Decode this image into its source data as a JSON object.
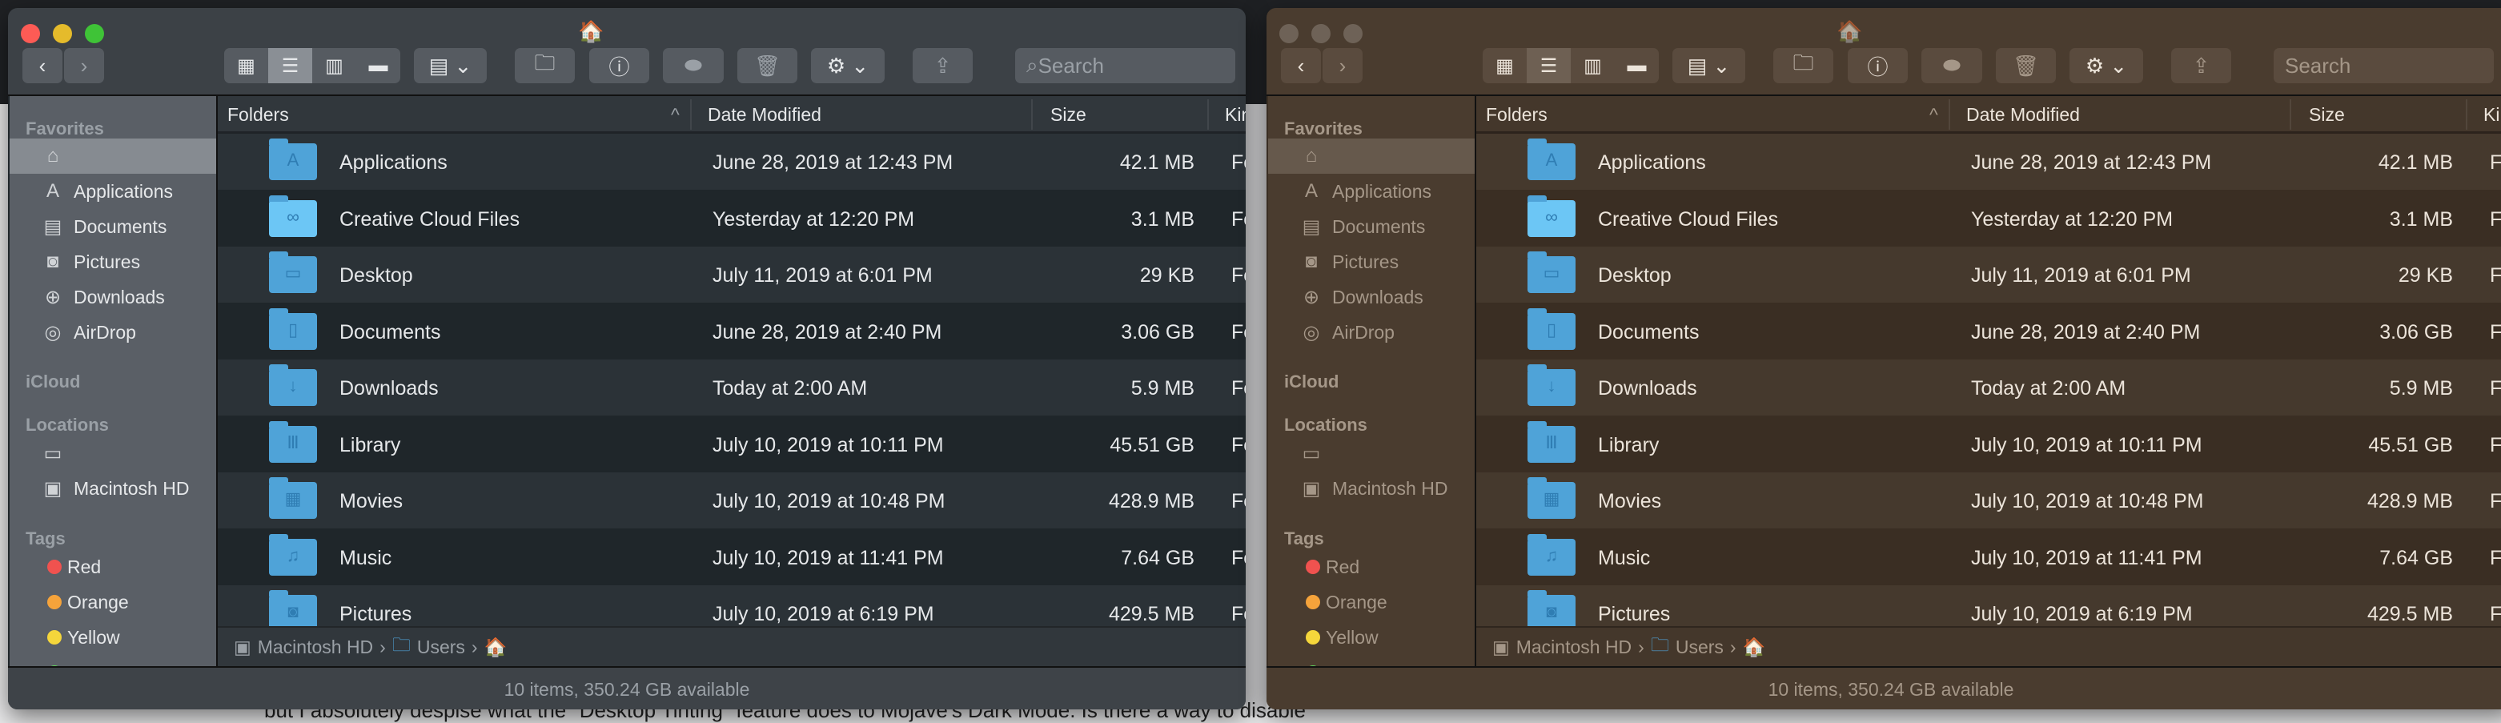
{
  "background_text": "but I absolutely despise what the \"Desktop Tinting\" feature does to Mojave's Dark Mode. Is there a way to disable",
  "toolbar": {
    "search_placeholder": "Search",
    "icons": [
      "back-icon",
      "forward-icon",
      "icon-view-icon",
      "list-view-icon",
      "column-view-icon",
      "gallery-view-icon",
      "group-icon",
      "new-folder-icon",
      "info-icon",
      "tag-icon",
      "trash-icon",
      "gear-icon",
      "share-icon",
      "search-icon"
    ]
  },
  "sidebar": {
    "favorites_label": "Favorites",
    "favorites": [
      {
        "label": "",
        "icon": "home-icon"
      },
      {
        "label": "Applications",
        "icon": "applications-icon"
      },
      {
        "label": "Documents",
        "icon": "documents-icon"
      },
      {
        "label": "Pictures",
        "icon": "camera-icon"
      },
      {
        "label": "Downloads",
        "icon": "downloads-icon"
      },
      {
        "label": "AirDrop",
        "icon": "airdrop-icon"
      }
    ],
    "icloud_label": "iCloud",
    "locations_label": "Locations",
    "locations": [
      {
        "label": "",
        "icon": "laptop-icon"
      },
      {
        "label": "Macintosh HD",
        "icon": "disk-icon"
      }
    ],
    "tags_label": "Tags",
    "tags": [
      {
        "label": "Red",
        "color": "#f0524f"
      },
      {
        "label": "Orange",
        "color": "#f5a33b"
      },
      {
        "label": "Yellow",
        "color": "#f5d63b"
      },
      {
        "label": "Green",
        "color": "#5fd35a"
      }
    ]
  },
  "columns": {
    "name": "Folders",
    "date": "Date Modified",
    "size": "Size",
    "kind": "Kind"
  },
  "rows": [
    {
      "name": "Applications",
      "date": "June 28, 2019 at 12:43 PM",
      "size": "42.1 MB",
      "kind": "Folder",
      "glyph": "applications"
    },
    {
      "name": "Creative Cloud Files",
      "date": "Yesterday at 12:20 PM",
      "size": "3.1 MB",
      "kind": "Folder",
      "glyph": "creative-cloud"
    },
    {
      "name": "Desktop",
      "date": "July 11, 2019 at 6:01 PM",
      "size": "29 KB",
      "kind": "Folder",
      "glyph": "desktop"
    },
    {
      "name": "Documents",
      "date": "June 28, 2019 at 2:40 PM",
      "size": "3.06 GB",
      "kind": "Folder",
      "glyph": "documents"
    },
    {
      "name": "Downloads",
      "date": "Today at 2:00 AM",
      "size": "5.9 MB",
      "kind": "Folder",
      "glyph": "downloads"
    },
    {
      "name": "Library",
      "date": "July 10, 2019 at 10:11 PM",
      "size": "45.51 GB",
      "kind": "Folder",
      "glyph": "library"
    },
    {
      "name": "Movies",
      "date": "July 10, 2019 at 10:48 PM",
      "size": "428.9 MB",
      "kind": "Folder",
      "glyph": "movies"
    },
    {
      "name": "Music",
      "date": "July 10, 2019 at 11:41 PM",
      "size": "7.64 GB",
      "kind": "Folder",
      "glyph": "music"
    },
    {
      "name": "Pictures",
      "date": "July 10, 2019 at 6:19 PM",
      "size": "429.5 MB",
      "kind": "Folder",
      "glyph": "pictures"
    }
  ],
  "path": [
    "Macintosh HD",
    "Users"
  ],
  "status": "10 items, 350.24 GB available",
  "windows": [
    {
      "theme": "dark-graphite",
      "colors": {
        "titlebar": "#3c4146",
        "sidebar": "#5a5f66",
        "header": "#31373c",
        "row_a": "#2b3237",
        "row_b": "#1f262a",
        "text": "#e6e8ea",
        "dim": "#9aa0a6",
        "btn": "#565b61",
        "status": "#3e4348"
      },
      "traffic": [
        "#fd5b55",
        "#e5bb2b",
        "#3fc337"
      ]
    },
    {
      "theme": "desktop-tinted",
      "colors": {
        "titlebar": "#4a3c2f",
        "sidebar": "#4a3c2f",
        "header": "#44372b",
        "row_a": "#45392d",
        "row_b": "#3a2e23",
        "text": "#ece4da",
        "dim": "#a59788",
        "btn": "#5a4b3e",
        "status": "#4a3c2f"
      },
      "traffic": [
        "#6e6257",
        "#6e6257",
        "#6e6257"
      ]
    }
  ]
}
